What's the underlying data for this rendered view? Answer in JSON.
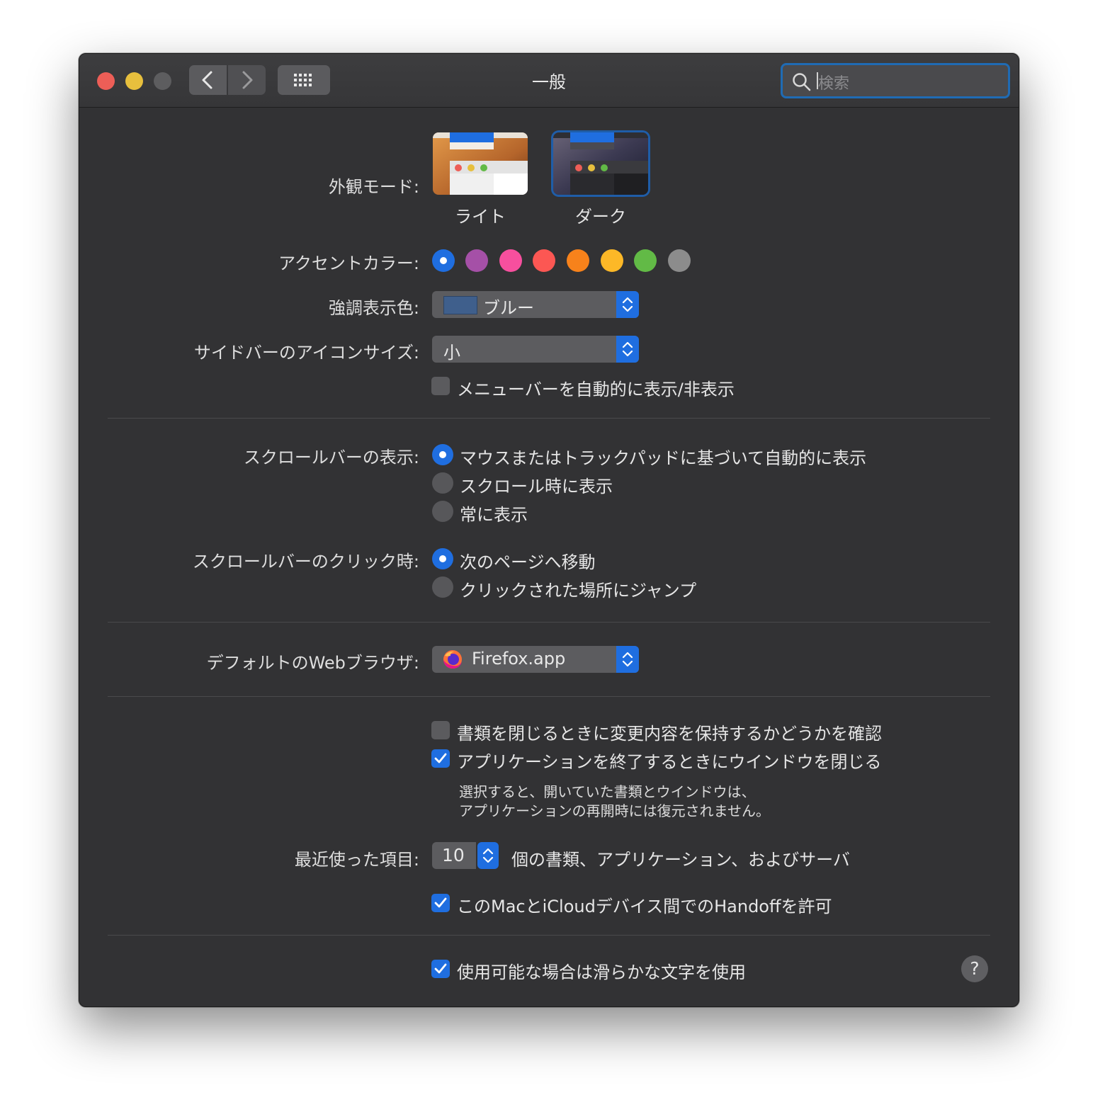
{
  "window": {
    "title": "一般",
    "search_placeholder": "検索"
  },
  "appearance": {
    "label": "外観モード:",
    "options": [
      {
        "name": "ライト",
        "selected": false
      },
      {
        "name": "ダーク",
        "selected": true
      }
    ]
  },
  "accent": {
    "label": "アクセントカラー:",
    "colors": [
      "#1f6ee0",
      "#a550a7",
      "#f74f9e",
      "#fc5753",
      "#f7821b",
      "#fdb827",
      "#62ba46",
      "#8c8c8c"
    ],
    "selected_index": 0
  },
  "highlight": {
    "label": "強調表示色:",
    "value": "ブルー",
    "chip_color": "#3f5f8c"
  },
  "sidebar_icon_size": {
    "label": "サイドバーのアイコンサイズ:",
    "value": "小"
  },
  "menubar_autohide": {
    "label": "メニューバーを自動的に表示/非表示",
    "checked": false
  },
  "scrollbar_show": {
    "label": "スクロールバーの表示:",
    "options": [
      {
        "label": "マウスまたはトラックパッドに基づいて自動的に表示",
        "selected": true
      },
      {
        "label": "スクロール時に表示",
        "selected": false
      },
      {
        "label": "常に表示",
        "selected": false
      }
    ]
  },
  "scrollbar_click": {
    "label": "スクロールバーのクリック時:",
    "options": [
      {
        "label": "次のページへ移動",
        "selected": true
      },
      {
        "label": "クリックされた場所にジャンプ",
        "selected": false
      }
    ]
  },
  "default_browser": {
    "label": "デフォルトのWebブラウザ:",
    "value": "Firefox.app"
  },
  "ask_keep_changes": {
    "label": "書類を閉じるときに変更内容を保持するかどうかを確認",
    "checked": false
  },
  "close_windows": {
    "label": "アプリケーションを終了するときにウインドウを閉じる",
    "checked": true,
    "note_line1": "選択すると、開いていた書類とウインドウは、",
    "note_line2": "アプリケーションの再開時には復元されません。"
  },
  "recent_items": {
    "label": "最近使った項目:",
    "value": "10",
    "suffix": "個の書類、アプリケーション、およびサーバ"
  },
  "handoff": {
    "label": "このMacとiCloudデバイス間でのHandoffを許可",
    "checked": true
  },
  "font_smoothing": {
    "label": "使用可能な場合は滑らかな文字を使用",
    "checked": true
  },
  "help": {
    "label": "?"
  }
}
